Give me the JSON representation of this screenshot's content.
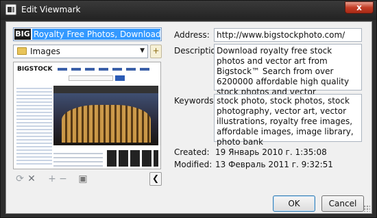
{
  "window": {
    "title": "Edit Viewmark",
    "close_glyph": "x"
  },
  "left": {
    "name_icon_text": "BIG",
    "name_value": "Royalty Free Photos, Download Stock Photo",
    "folder": {
      "selected": "Images",
      "icon": "folder-icon"
    },
    "toolbar_icons": [
      "refresh-icon",
      "delete-icon",
      "add-icon",
      "remove-icon",
      "save-icon",
      "collapse-left-icon"
    ]
  },
  "fields": {
    "address_label": "Address:",
    "address_value": "http://www.bigstockphoto.com/",
    "description_label": "Description:",
    "description_value": "Download royalty free stock photos and vector art from Bigstock™ Search from over 6200000 affordable high quality stock photos and vector illustrations.",
    "keywords_label": "Keywords:",
    "keywords_value": "stock photo, stock photos, stock photography, vector art, vector illustrations, royalty free images, affordable images, image library, photo bank",
    "created_label": "Created:",
    "created_value": "19 Январь 2010 г. 1:35:08",
    "modified_label": "Modified:",
    "modified_value": "13 Февраль 2011 г. 9:32:51"
  },
  "buttons": {
    "ok_label": "OK",
    "cancel_label": "Cancel"
  },
  "colors": {
    "title_bar": "#2d2d2d",
    "close": "#c33d26",
    "selection": "#3399ff"
  }
}
